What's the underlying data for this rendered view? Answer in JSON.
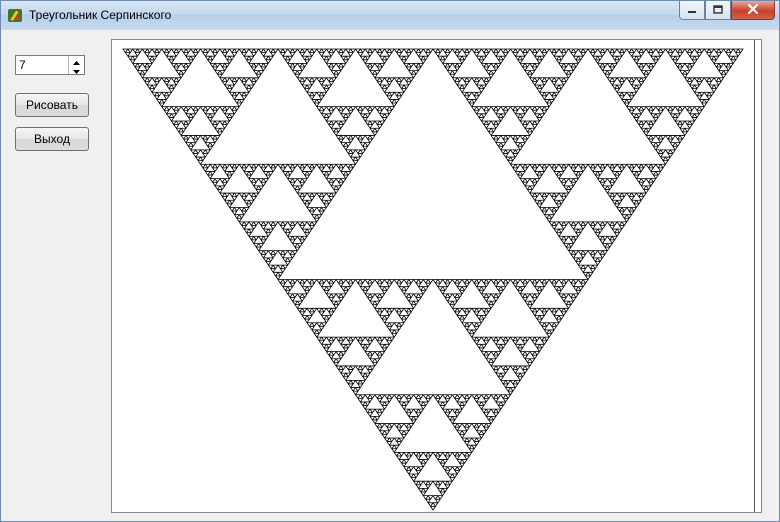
{
  "window": {
    "title": "Треугольник Серпинского",
    "controls": {
      "minimize": "minimize-icon",
      "maximize": "maximize-icon",
      "close": "close-icon"
    }
  },
  "controls": {
    "depth_value": "7",
    "draw_label": "Рисовать",
    "exit_label": "Выход"
  },
  "canvas": {
    "figure": "sierpinski-triangle",
    "recursion_depth": 7,
    "orientation": "inverted",
    "stroke_color": "#000000",
    "background": "#ffffff"
  }
}
